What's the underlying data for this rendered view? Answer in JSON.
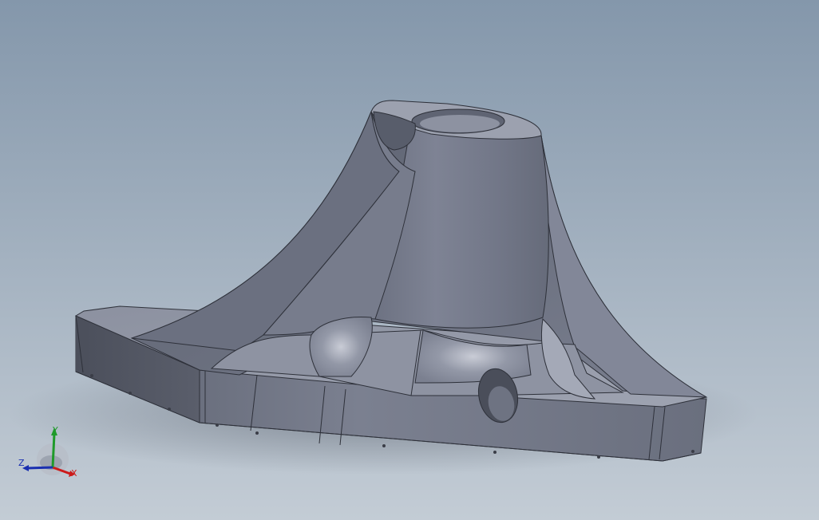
{
  "viewport": {
    "background_top": "#8497ab",
    "background_bottom": "#c3ccd5",
    "model_color": "#7d8293"
  },
  "triad": {
    "x_label": "X",
    "y_label": "Y",
    "z_label": "Z",
    "x_color": "#cc1a1a",
    "y_color": "#1f9a2a",
    "z_color": "#1a2fb0"
  }
}
